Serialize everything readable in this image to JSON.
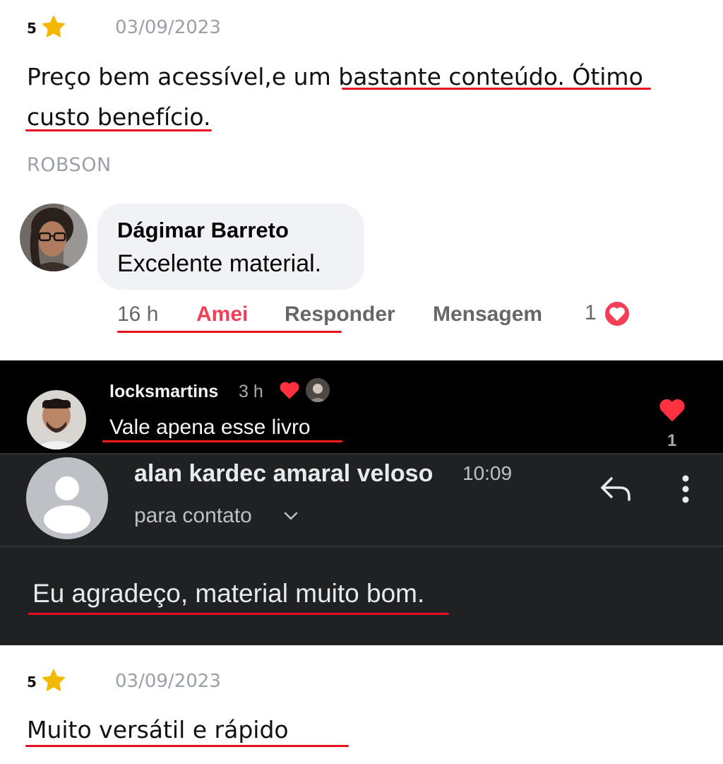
{
  "review1": {
    "rating": "5",
    "date": "03/09/2023",
    "text_line1_plain": "Preço bem acessível,e um ",
    "text_line1_marked": "bastante conteúdo. Ótimo",
    "text_line2": "custo benefício.",
    "reviewer": "ROBSON"
  },
  "facebook_comment": {
    "author": "Dágimar Barreto",
    "text": "Excelente material.",
    "time": "16 h",
    "like_label": "Amei",
    "reply_label": "Responder",
    "message_label": "Mensagem",
    "reaction_count": "1",
    "colors": {
      "bubble": "#f0f2f5",
      "love": "#f33e58"
    }
  },
  "instagram_comment": {
    "username": "locksmartins",
    "time": "3 h",
    "text": "Vale apena esse livro",
    "like_count": "1"
  },
  "email": {
    "sender": "alan kardec amaral veloso",
    "time": "10:09",
    "recipient": "para contato",
    "body": "Eu agradeço, material muito bom."
  },
  "review2": {
    "rating": "5",
    "date": "03/09/2023",
    "text": "Muito versátil e rápido"
  },
  "colors": {
    "underline": "#e8121f",
    "star": "#f5b800",
    "ig_background": "#000000",
    "gmail_background": "#1f2123"
  }
}
